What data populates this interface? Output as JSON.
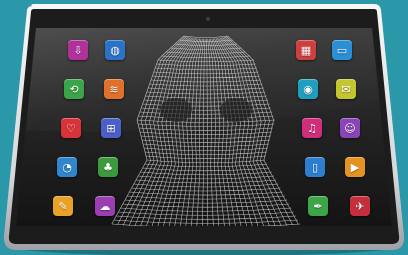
{
  "background_color": "#2a98a8",
  "device": {
    "bezel_color": "#1c1c1c",
    "frame_color": "#e9eaec",
    "screen_color": "#262626",
    "mesh_color": "#dcdcdc"
  },
  "app_icons": [
    {
      "name": "download-app-icon",
      "color": "#b0319a",
      "glyph": "⇩"
    },
    {
      "name": "globe-app-icon",
      "color": "#2a73c8",
      "glyph": "◍"
    },
    {
      "name": "refresh-app-icon",
      "color": "#3aa548",
      "glyph": "⟲"
    },
    {
      "name": "signal-app-icon",
      "color": "#e0702a",
      "glyph": "≋"
    },
    {
      "name": "heart-app-icon",
      "color": "#d8323a",
      "glyph": "♡"
    },
    {
      "name": "basket-app-icon",
      "color": "#4a5fc8",
      "glyph": "⊞"
    },
    {
      "name": "dial-app-icon",
      "color": "#2f86cc",
      "glyph": "◔"
    },
    {
      "name": "tree-app-icon",
      "color": "#3c9a3e",
      "glyph": "♣"
    },
    {
      "name": "notes-app-icon",
      "color": "#e8a225",
      "glyph": "✎"
    },
    {
      "name": "cloud-app-icon",
      "color": "#9b3fb0",
      "glyph": "☁"
    },
    {
      "name": "calculator-app-icon",
      "color": "#cf3f3f",
      "glyph": "▦"
    },
    {
      "name": "image-app-icon",
      "color": "#2b8fd6",
      "glyph": "▭"
    },
    {
      "name": "camera-app-icon",
      "color": "#1f9fbf",
      "glyph": "◉"
    },
    {
      "name": "mail-app-icon",
      "color": "#c4c630",
      "glyph": "✉"
    },
    {
      "name": "music-app-icon",
      "color": "#cf2f7a",
      "glyph": "♫"
    },
    {
      "name": "person-app-icon",
      "color": "#8b44b8",
      "glyph": "☺"
    },
    {
      "name": "phone-app-icon",
      "color": "#2c7ed0",
      "glyph": "▯"
    },
    {
      "name": "video-app-icon",
      "color": "#e69222",
      "glyph": "▶"
    },
    {
      "name": "pen-app-icon",
      "color": "#3da447",
      "glyph": "✒"
    },
    {
      "name": "plane-app-icon",
      "color": "#c52f3d",
      "glyph": "✈"
    }
  ]
}
